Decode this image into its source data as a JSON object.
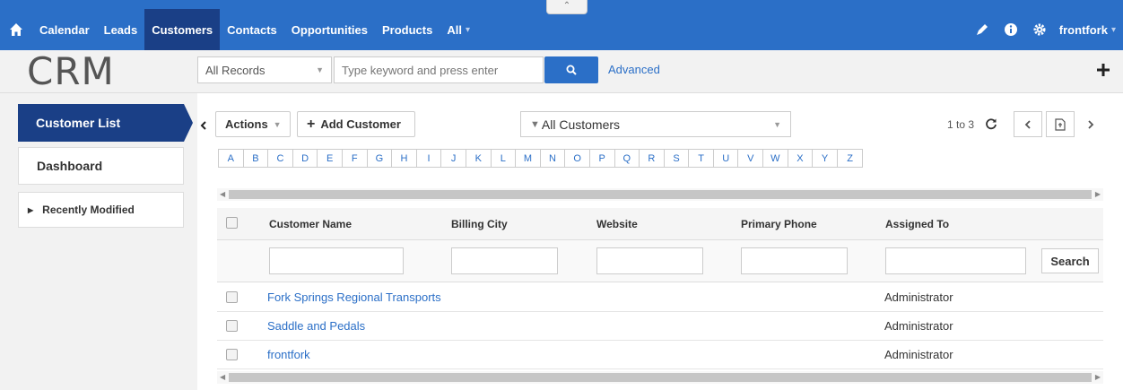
{
  "nav": {
    "items": [
      {
        "label": "Calendar",
        "active": false
      },
      {
        "label": "Leads",
        "active": false
      },
      {
        "label": "Customers",
        "active": true
      },
      {
        "label": "Contacts",
        "active": false
      },
      {
        "label": "Opportunities",
        "active": false
      },
      {
        "label": "Products",
        "active": false
      }
    ],
    "more_label": "All",
    "user": "frontfork"
  },
  "header": {
    "logo": "CRM",
    "record_filter": "All Records",
    "search_placeholder": "Type keyword and press enter",
    "advanced_label": "Advanced"
  },
  "sidebar": {
    "active": "Customer List",
    "dashboard": "Dashboard",
    "recent": "Recently Modified"
  },
  "toolbar": {
    "actions_label": "Actions",
    "add_label": "Add Customer",
    "list_filter": "All Customers",
    "paging": "1 to 3"
  },
  "alphabet": [
    "A",
    "B",
    "C",
    "D",
    "E",
    "F",
    "G",
    "H",
    "I",
    "J",
    "K",
    "L",
    "M",
    "N",
    "O",
    "P",
    "Q",
    "R",
    "S",
    "T",
    "U",
    "V",
    "W",
    "X",
    "Y",
    "Z"
  ],
  "table": {
    "columns": [
      "Customer Name",
      "Billing City",
      "Website",
      "Primary Phone",
      "Assigned To"
    ],
    "search_label": "Search",
    "rows": [
      {
        "name": "Fork Springs Regional Transports",
        "billing_city": "",
        "website": "",
        "phone": "",
        "assigned": "Administrator"
      },
      {
        "name": "Saddle and Pedals",
        "billing_city": "",
        "website": "",
        "phone": "",
        "assigned": "Administrator"
      },
      {
        "name": "frontfork",
        "billing_city": "",
        "website": "",
        "phone": "",
        "assigned": "Administrator"
      }
    ]
  },
  "colors": {
    "nav_bg": "#2b6fc7",
    "nav_active": "#1a3f86",
    "link": "#2b6fc7"
  }
}
